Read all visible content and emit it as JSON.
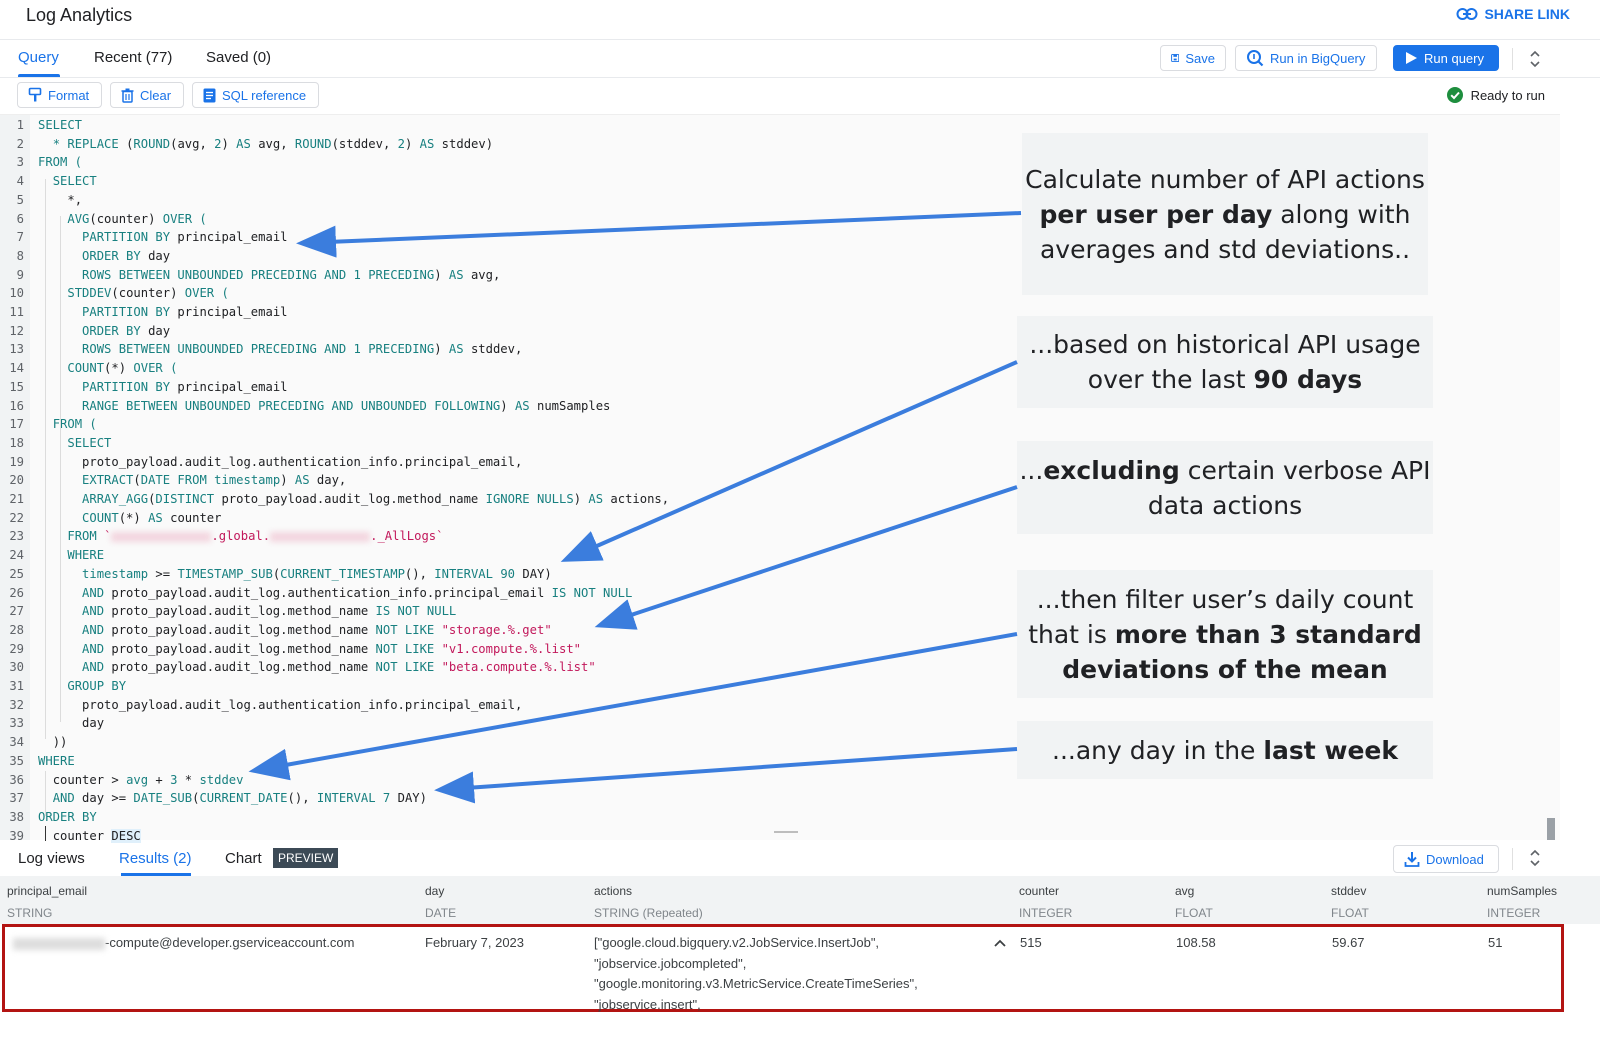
{
  "header": {
    "title": "Log Analytics",
    "share_link": "SHARE LINK"
  },
  "tabs": [
    {
      "label": "Query",
      "active": true
    },
    {
      "label": "Recent (77)",
      "active": false
    },
    {
      "label": "Saved (0)",
      "active": false
    }
  ],
  "toolbar": {
    "save": "Save",
    "run_in_bigquery": "Run in BigQuery",
    "run_query": "Run query",
    "format": "Format",
    "clear": "Clear",
    "sql_reference": "SQL reference",
    "status": "Ready to run",
    "accent_color": "#1a73e8",
    "status_color": "#1e8e3e"
  },
  "code": {
    "lines": [
      {
        "n": "1"
      },
      {
        "n": "2"
      },
      {
        "n": "3"
      },
      {
        "n": "4"
      },
      {
        "n": "5"
      },
      {
        "n": "6"
      },
      {
        "n": "7"
      },
      {
        "n": "8"
      },
      {
        "n": "9"
      },
      {
        "n": "10"
      },
      {
        "n": "11"
      },
      {
        "n": "12"
      },
      {
        "n": "13"
      },
      {
        "n": "14"
      },
      {
        "n": "15"
      },
      {
        "n": "16"
      },
      {
        "n": "17"
      },
      {
        "n": "18"
      },
      {
        "n": "19"
      },
      {
        "n": "20"
      },
      {
        "n": "21"
      },
      {
        "n": "22"
      },
      {
        "n": "23"
      },
      {
        "n": "24"
      },
      {
        "n": "25"
      },
      {
        "n": "26"
      },
      {
        "n": "27"
      },
      {
        "n": "28"
      },
      {
        "n": "29"
      },
      {
        "n": "30"
      },
      {
        "n": "31"
      },
      {
        "n": "32"
      },
      {
        "n": "33"
      },
      {
        "n": "34"
      },
      {
        "n": "35"
      },
      {
        "n": "36"
      },
      {
        "n": "37"
      },
      {
        "n": "38"
      },
      {
        "n": "39"
      }
    ],
    "tokens": {
      "select": "SELECT",
      "replace": "* REPLACE",
      "l2_rest_a": " (",
      "round": "ROUND",
      "l2_avg": "(avg, ",
      "two": "2",
      "l2_close": ") ",
      "as": "AS",
      "l2_avg2": " avg, ",
      "l2_stddev": "(stddev, ",
      "l2_stddev2": " stddev)",
      "from_open": "FROM (",
      "star_comma": "*,",
      "avg_fn": "AVG",
      "counter_paren": "(counter) ",
      "over_open": "OVER (",
      "partition_by": "PARTITION BY",
      "principal_email": " principal_email",
      "order_by": "ORDER BY",
      "day": " day",
      "rows_between": "ROWS BETWEEN UNBOUNDED PRECEDING AND 1 PRECEDING",
      "paren_close": ") ",
      "avg_alias": " avg,",
      "stddev_fn": "STDDEV",
      "stddev_alias": " stddev,",
      "count_fn": "COUNT",
      "count_star": "(*) ",
      "range_between": "RANGE BETWEEN UNBOUNDED PRECEDING AND UNBOUNDED FOLLOWING",
      "numsamples": " numSamples",
      "from": "FROM",
      "l19": "proto_payload.audit_log.authentication_info.principal_email,",
      "extract": "EXTRACT",
      "date_from": "DATE FROM",
      "timestamp_kw": "timestamp",
      "day_comma": " day,",
      "array_agg": "ARRAY_AGG",
      "distinct": "DISTINCT",
      "method_name_ref": " proto_payload.audit_log.method_name ",
      "ignore_nulls": "IGNORE NULLS",
      "actions_alias": " actions,",
      "counter_alias": " counter",
      "backtick": "`",
      "global": ".global.",
      "alllogs": "._AllLogs`",
      "where": "WHERE",
      "timestamp_ge": " >= ",
      "timestamp_sub": "TIMESTAMP_SUB",
      "current_timestamp": "CURRENT_TIMESTAMP",
      "interval": "INTERVAL",
      "ninety": "90",
      "day_close": " DAY)",
      "and": "AND",
      "email_ref": " proto_payload.audit_log.authentication_info.principal_email ",
      "is_not_null": "IS NOT NULL",
      "not_like": "NOT LIKE",
      "pat1": "\"storage.%.get\"",
      "pat2": "\"v1.compute.%.list\"",
      "pat3": "\"beta.compute.%.list\"",
      "group_by": "GROUP BY",
      "day_plain": "day",
      "close2": "))",
      "counter_gt": "counter > ",
      "avg_word": "avg",
      "plus": " + ",
      "three": "3",
      "times": " * ",
      "stddev_word": "stddev",
      "day_ge": " day >= ",
      "date_sub": "DATE_SUB",
      "current_date": "CURRENT_DATE",
      "seven": "7",
      "counter": "counter ",
      "desc": "DESC",
      "paren_open": "(",
      "paren_empty": "(), ",
      "space": " "
    }
  },
  "annotations": [
    {
      "pre": "Calculate number of API actions ",
      "bold": "per user per day",
      "post": " along with averages and std deviations.."
    },
    {
      "pre": "...based on historical API usage over the last ",
      "bold": "90 days",
      "post": ""
    },
    {
      "pre": "...",
      "bold": "excluding",
      "post": " certain verbose API data actions"
    },
    {
      "pre": "...then filter user’s daily count that is ",
      "bold": "more than 3 standard deviations of the mean",
      "post": ""
    },
    {
      "pre": "...any day in the ",
      "bold": "last week",
      "post": ""
    }
  ],
  "results": {
    "tabs": [
      {
        "label": "Log views",
        "active": false
      },
      {
        "label": "Results (2)",
        "active": true
      },
      {
        "label": "Chart",
        "active": false
      }
    ],
    "preview_badge": "PREVIEW",
    "download": "Download",
    "columns": [
      {
        "name": "principal_email",
        "type": "STRING"
      },
      {
        "name": "day",
        "type": "DATE"
      },
      {
        "name": "actions",
        "type": "STRING (Repeated)"
      },
      {
        "name": "counter",
        "type": "INTEGER"
      },
      {
        "name": "avg",
        "type": "FLOAT"
      },
      {
        "name": "stddev",
        "type": "FLOAT"
      },
      {
        "name": "numSamples",
        "type": "INTEGER"
      }
    ],
    "rows": [
      {
        "principal_email": "-compute@developer.gserviceaccount.com",
        "day": "February 7, 2023",
        "actions": [
          "[\"google.cloud.bigquery.v2.JobService.InsertJob\",",
          "\"jobservice.jobcompleted\",",
          "\"google.monitoring.v3.MetricService.CreateTimeSeries\",",
          "\"jobservice.insert\","
        ],
        "counter": "515",
        "avg": "108.58",
        "stddev": "59.67",
        "numSamples": "51"
      }
    ],
    "highlight_color": "#b31412"
  }
}
